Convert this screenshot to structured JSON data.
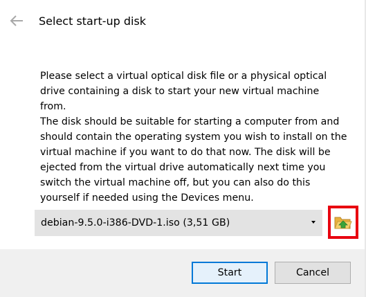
{
  "header": {
    "back_icon": "arrow-left-icon",
    "title": "Select start-up disk"
  },
  "body": {
    "paragraph1": "Please select a virtual optical disk file or a physical optical drive containing a disk to start your new virtual machine from.",
    "paragraph2": "The disk should be suitable for starting a computer from and should contain the operating system you wish to install on the virtual machine if you want to do that now. The disk will be ejected from the virtual drive automatically next time you switch the virtual machine off, but you can also do this yourself if needed using the Devices menu."
  },
  "disk_selector": {
    "selected_value": "debian-9.5.0-i386-DVD-1.iso (3,51 GB)",
    "dropdown_icon": "chevron-down-icon"
  },
  "folder_button": {
    "icon": "folder-open-icon",
    "highlight_color": "#e8000f"
  },
  "footer": {
    "start_label": "Start",
    "cancel_label": "Cancel"
  },
  "colors": {
    "accent": "#0078d7",
    "combo_bg": "#e3e3e3",
    "footer_bg": "#f0f0f0"
  }
}
